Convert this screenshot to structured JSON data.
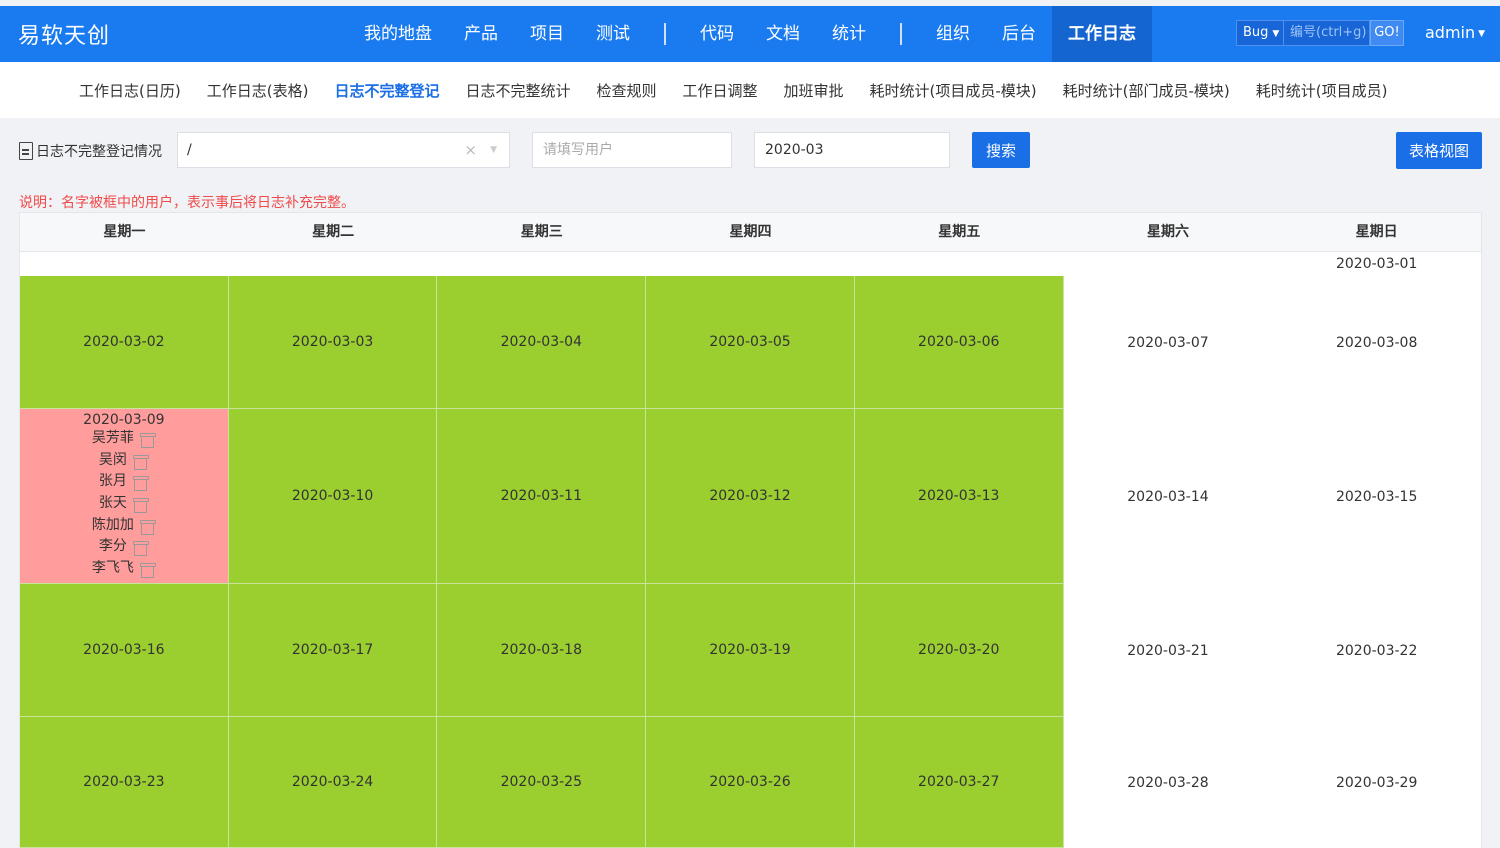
{
  "header": {
    "brand": "易软天创",
    "nav": [
      "我的地盘",
      "产品",
      "项目",
      "测试",
      "代码",
      "文档",
      "统计",
      "组织",
      "后台",
      "工作日志"
    ],
    "active_nav": "工作日志",
    "bug_select": "Bug",
    "bug_input_placeholder": "编号(ctrl+g)",
    "go_label": "GO!",
    "user": "admin"
  },
  "subnav": [
    "工作日志(日历)",
    "工作日志(表格)",
    "日志不完整登记",
    "日志不完整统计",
    "检查规则",
    "工作日调整",
    "加班审批",
    "耗时统计(项目成员-模块)",
    "耗时统计(部门成员-模块)",
    "耗时统计(项目成员)"
  ],
  "active_subnav": "日志不完整登记",
  "toolbar": {
    "title": "日志不完整登记情况",
    "select_value": "/",
    "clear_icon": "×",
    "user_placeholder": "请填写用户",
    "month_value": "2020-03",
    "search_label": "搜索",
    "table_view_label": "表格视图"
  },
  "note": "说明：名字被框中的用户，表示事后将日志补充完整。",
  "calendar": {
    "weekdays": [
      "星期一",
      "星期二",
      "星期三",
      "星期四",
      "星期五",
      "星期六",
      "星期日"
    ],
    "row0": {
      "sun": "2020-03-01"
    },
    "week1": [
      "2020-03-02",
      "2020-03-03",
      "2020-03-04",
      "2020-03-05",
      "2020-03-06",
      "2020-03-07",
      "2020-03-08"
    ],
    "week2": [
      "2020-03-09",
      "2020-03-10",
      "2020-03-11",
      "2020-03-12",
      "2020-03-13",
      "2020-03-14",
      "2020-03-15"
    ],
    "week2_mon_users": [
      "吴芳菲",
      "吴闵",
      "张月",
      "张天",
      "陈加加",
      "李分",
      "李飞飞"
    ],
    "week3": [
      "2020-03-16",
      "2020-03-17",
      "2020-03-18",
      "2020-03-19",
      "2020-03-20",
      "2020-03-21",
      "2020-03-22"
    ],
    "week4": [
      "2020-03-23",
      "2020-03-24",
      "2020-03-25",
      "2020-03-26",
      "2020-03-27",
      "2020-03-28",
      "2020-03-29"
    ]
  },
  "colors": {
    "complete": "#9bcf2f",
    "incomplete": "#ff9c9c",
    "primary": "#1a6ee6",
    "header": "#1a7bf0"
  }
}
